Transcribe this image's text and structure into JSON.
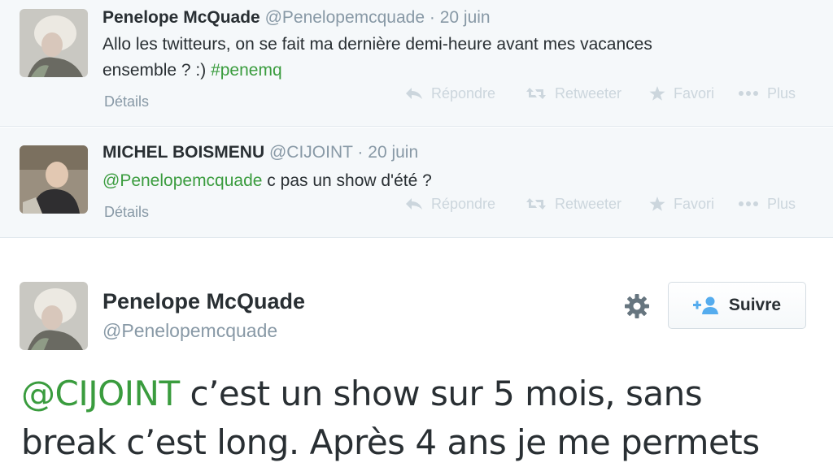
{
  "colors": {
    "link": "#3a9c3e",
    "meta": "#8899a6",
    "context_bg": "#f5f8fa",
    "action_disabled": "#ccd6dd"
  },
  "context_tweets": [
    {
      "name": "Penelope McQuade",
      "handle": "@Penelopemcquade",
      "separator": "·",
      "date": "20 juin",
      "text_line1": "Allo les twitteurs, on se fait ma dernière demi-heure avant mes vacances",
      "text_line2_prefix": "ensemble ? :) ",
      "hashtag": "#penemq",
      "details": "Détails",
      "avatar_icon": "user-avatar-icon"
    },
    {
      "name": "MICHEL BOISMENU",
      "handle": "@CIJOINT",
      "separator": "·",
      "date": "20 juin",
      "mention": "@Penelopemcquade",
      "text_rest": " c pas un show d'été ?",
      "details": "Détails",
      "avatar_icon": "user-avatar-icon"
    }
  ],
  "actions": {
    "reply": "Répondre",
    "retweet": "Retweeter",
    "favorite": "Favori",
    "more": "Plus"
  },
  "main_tweet": {
    "name": "Penelope McQuade",
    "handle": "@Penelopemcquade",
    "mention": "@CIJOINT",
    "text_line1": " c’est un show sur 5 mois, sans",
    "text_line2": "break c’est long. Après 4 ans je me permets",
    "follow_label": "Suivre",
    "gear_icon": "gear-icon",
    "follow_icon": "add-user-icon"
  }
}
